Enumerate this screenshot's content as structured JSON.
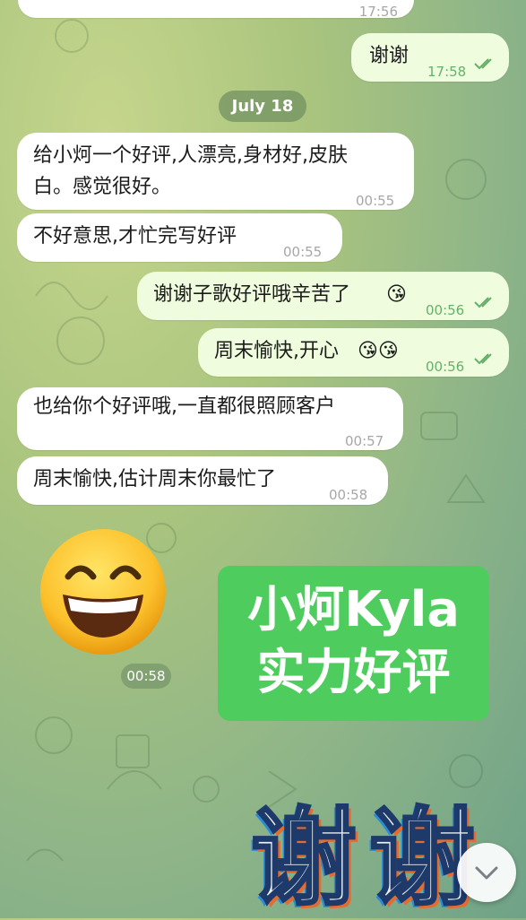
{
  "colors": {
    "incoming": "#ffffff",
    "outgoing": "#effdde",
    "accent": "#4ecc5e",
    "tick": "#66b06a"
  },
  "messages": [
    {
      "text": "",
      "time": "17:56"
    },
    {
      "text": "谢谢",
      "time": "17:58"
    },
    {
      "text": "给小炣一个好评,人漂亮,身材好,皮肤",
      "text2": "白。感觉很好。",
      "time": "00:55"
    },
    {
      "text": "不好意思,才忙完写好评",
      "time": "00:55"
    },
    {
      "text": "谢谢子歌好评哦辛苦了",
      "emoji": "😘",
      "time": "00:56"
    },
    {
      "text": "周末愉快,开心",
      "emoji": "😘😘",
      "time": "00:56"
    },
    {
      "text": "也给你个好评哦,一直都很照顾客户",
      "time": "00:57"
    },
    {
      "text": "周末愉快,估计周末你最忙了",
      "time": "00:58"
    }
  ],
  "date_divider": "July 18",
  "sticker": {
    "icon": "grinning-face-emoji",
    "time": "00:58"
  },
  "banner": {
    "line1": "小炣Kyla",
    "line2": "实力好评"
  },
  "overlay_text": "谢谢",
  "scroll_button_icon": "chevron-down-icon"
}
